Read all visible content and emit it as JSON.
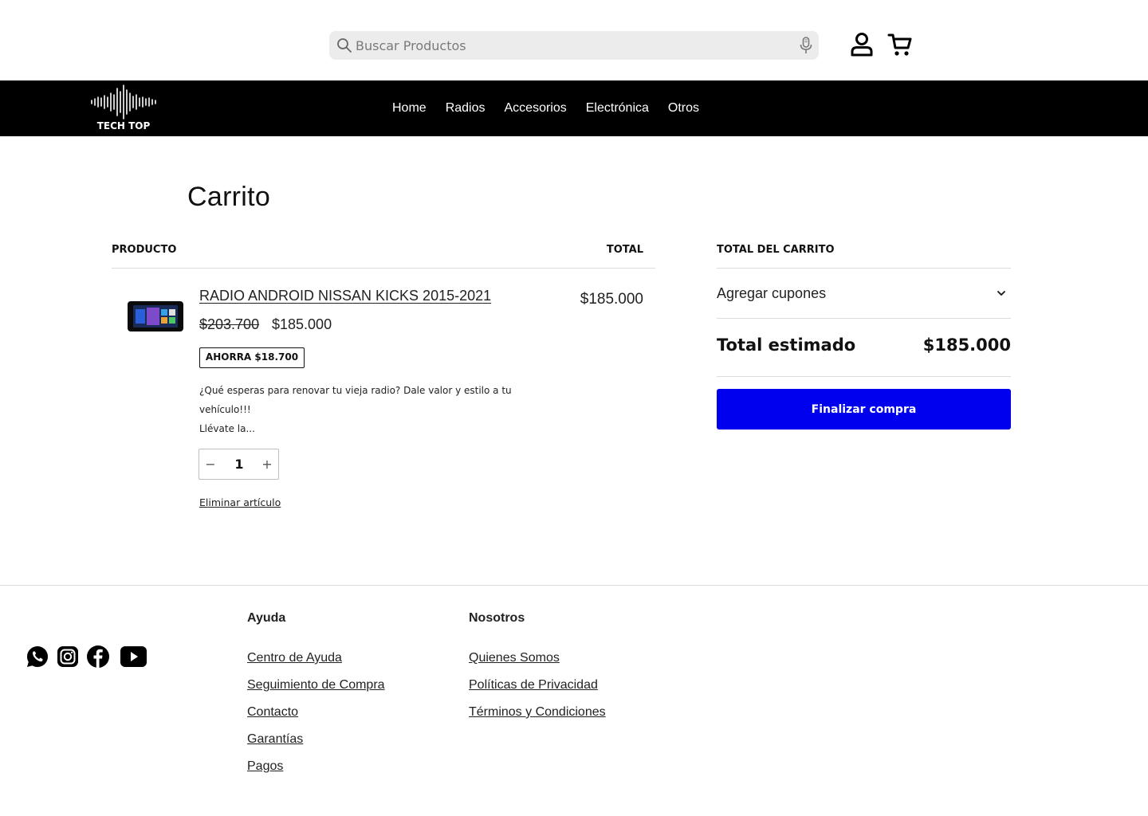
{
  "header": {
    "search_placeholder": "Buscar Productos"
  },
  "navbar": {
    "logo_text": "TECH TOP",
    "links": [
      "Home",
      "Radios",
      "Accesorios",
      "Electrónica",
      "Otros"
    ]
  },
  "cart": {
    "title": "Carrito",
    "col_product": "PRODUCTO",
    "col_total": "TOTAL",
    "item": {
      "name": "RADIO ANDROID NISSAN KICKS 2015-2021",
      "old_price": "$203.700",
      "price": "$185.000",
      "savings": "AHORRA $18.700",
      "description_1": "¿Qué esperas para renovar tu vieja radio? Dale valor y estilo a tu vehículo!!!",
      "description_2": "Llévate la...",
      "quantity": "1",
      "qty_minus": "−",
      "qty_plus": "+",
      "remove_label": "Eliminar artículo",
      "line_total": "$185.000"
    }
  },
  "summary": {
    "title": "TOTAL DEL CARRITO",
    "coupon_label": "Agregar cupones",
    "estimated_label": "Total estimado",
    "estimated_value": "$185.000",
    "checkout_label": "Finalizar compra",
    "checkout_color": "#0000ee"
  },
  "footer": {
    "social_icons": [
      "whatsapp-icon",
      "instagram-icon",
      "facebook-icon",
      "youtube-icon"
    ],
    "help": {
      "title": "Ayuda",
      "links": [
        "Centro de Ayuda",
        "Seguimiento de Compra",
        "Contacto",
        "Garantías",
        "Pagos"
      ]
    },
    "about": {
      "title": "Nosotros",
      "links": [
        "Quienes Somos",
        "Políticas de Privacidad",
        "Términos y Condiciones"
      ]
    }
  }
}
